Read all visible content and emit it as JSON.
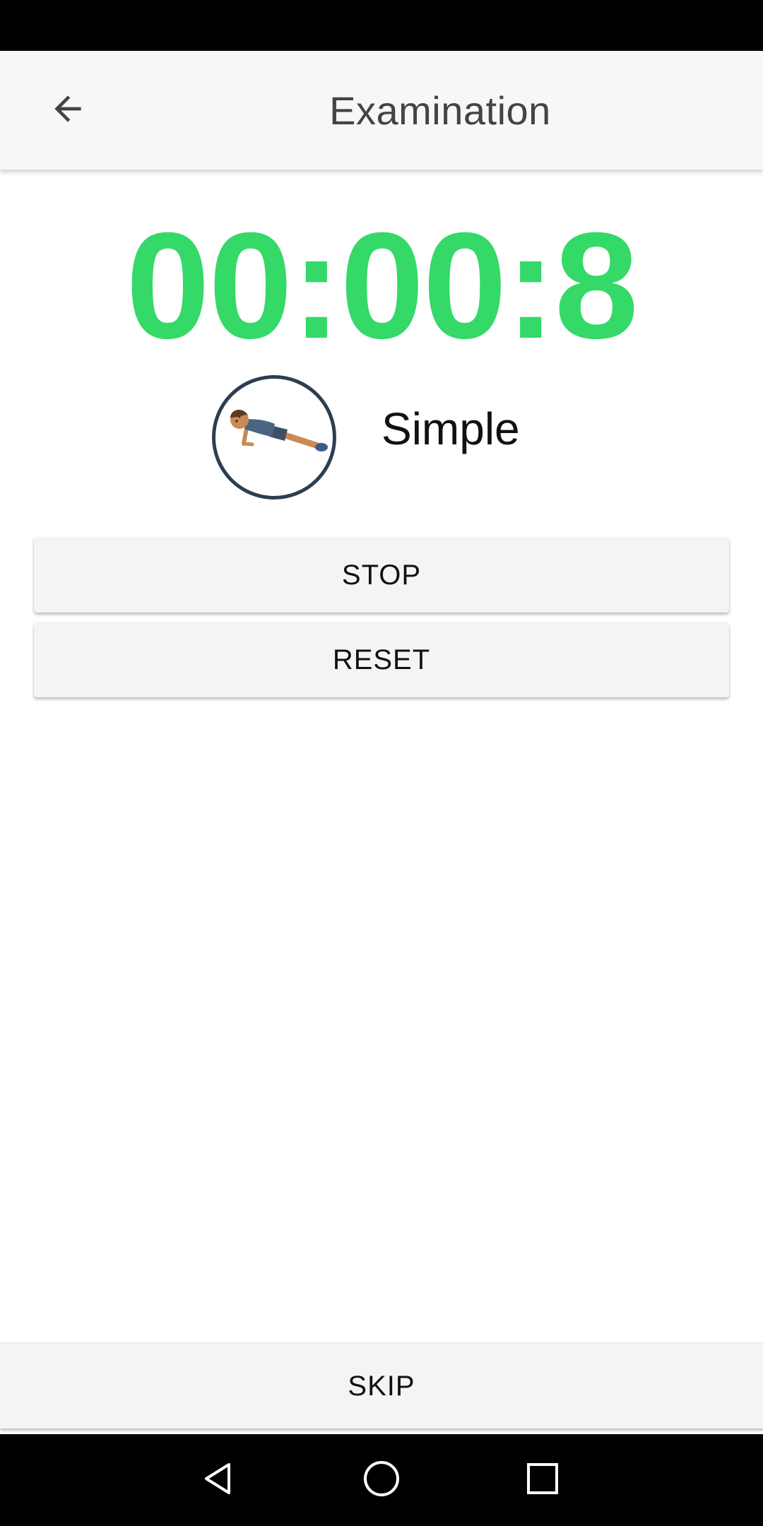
{
  "app_bar": {
    "title": "Examination",
    "back_icon": "arrow-left-icon"
  },
  "timer": {
    "value": "00:00:8",
    "color": "#34d968"
  },
  "exercise": {
    "name": "Simple",
    "image_icon": "push-up-illustration"
  },
  "actions": {
    "stop_label": "STOP",
    "reset_label": "RESET",
    "skip_label": "SKIP"
  },
  "system_nav": {
    "back_icon": "nav-back-icon",
    "home_icon": "nav-home-icon",
    "recents_icon": "nav-recents-icon"
  }
}
